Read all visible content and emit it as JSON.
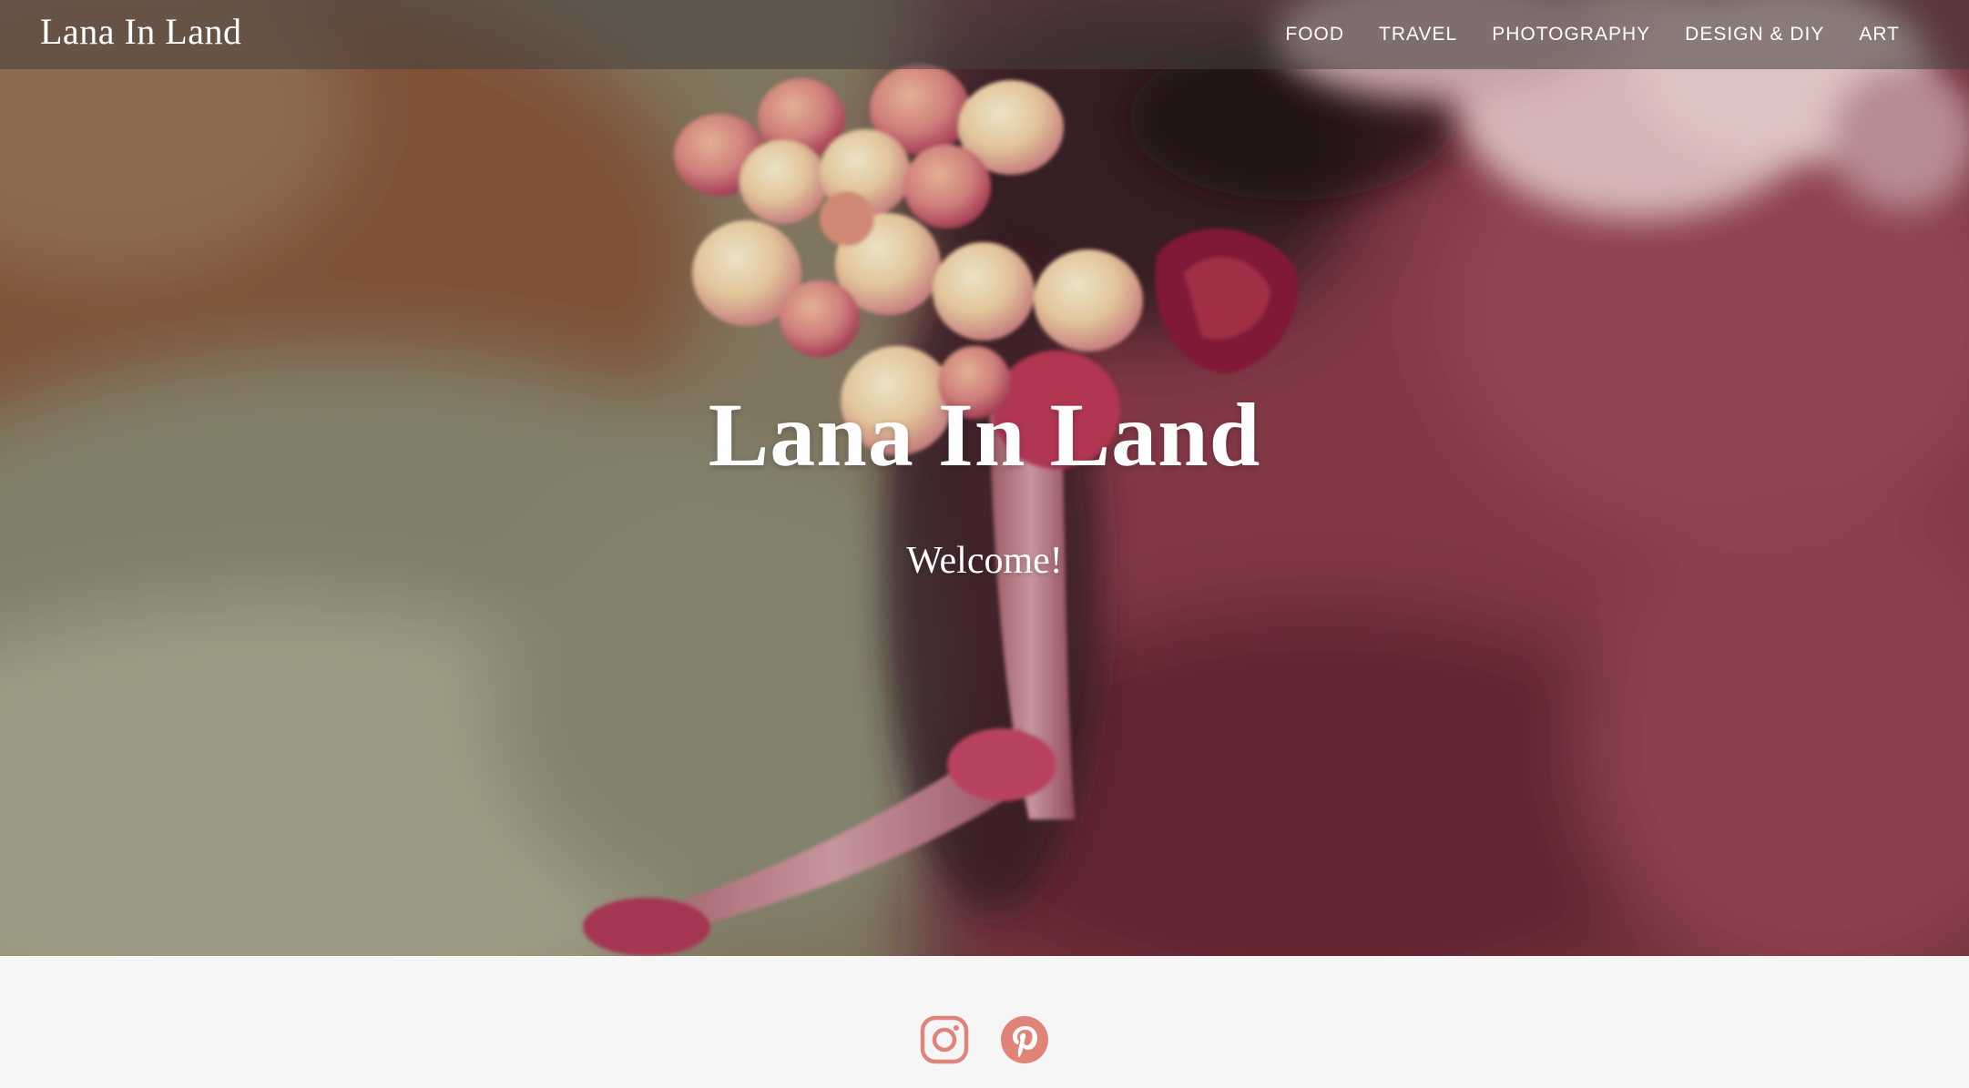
{
  "header": {
    "brand": "Lana In Land",
    "nav": [
      {
        "id": "food",
        "label": "FOOD"
      },
      {
        "id": "travel",
        "label": "TRAVEL"
      },
      {
        "id": "photography",
        "label": "PHOTOGRAPHY"
      },
      {
        "id": "design-diy",
        "label": "DESIGN & DIY"
      },
      {
        "id": "art",
        "label": "ART"
      }
    ]
  },
  "hero": {
    "title": "Lana In Land",
    "subtitle": "Welcome!"
  },
  "footer": {
    "social": [
      {
        "icon": "instagram-icon"
      },
      {
        "icon": "pinterest-icon"
      }
    ],
    "icon_color": "#e0847a"
  },
  "colors": {
    "nav_text": "#ffffff",
    "footer_bg": "#f6f6f6"
  }
}
